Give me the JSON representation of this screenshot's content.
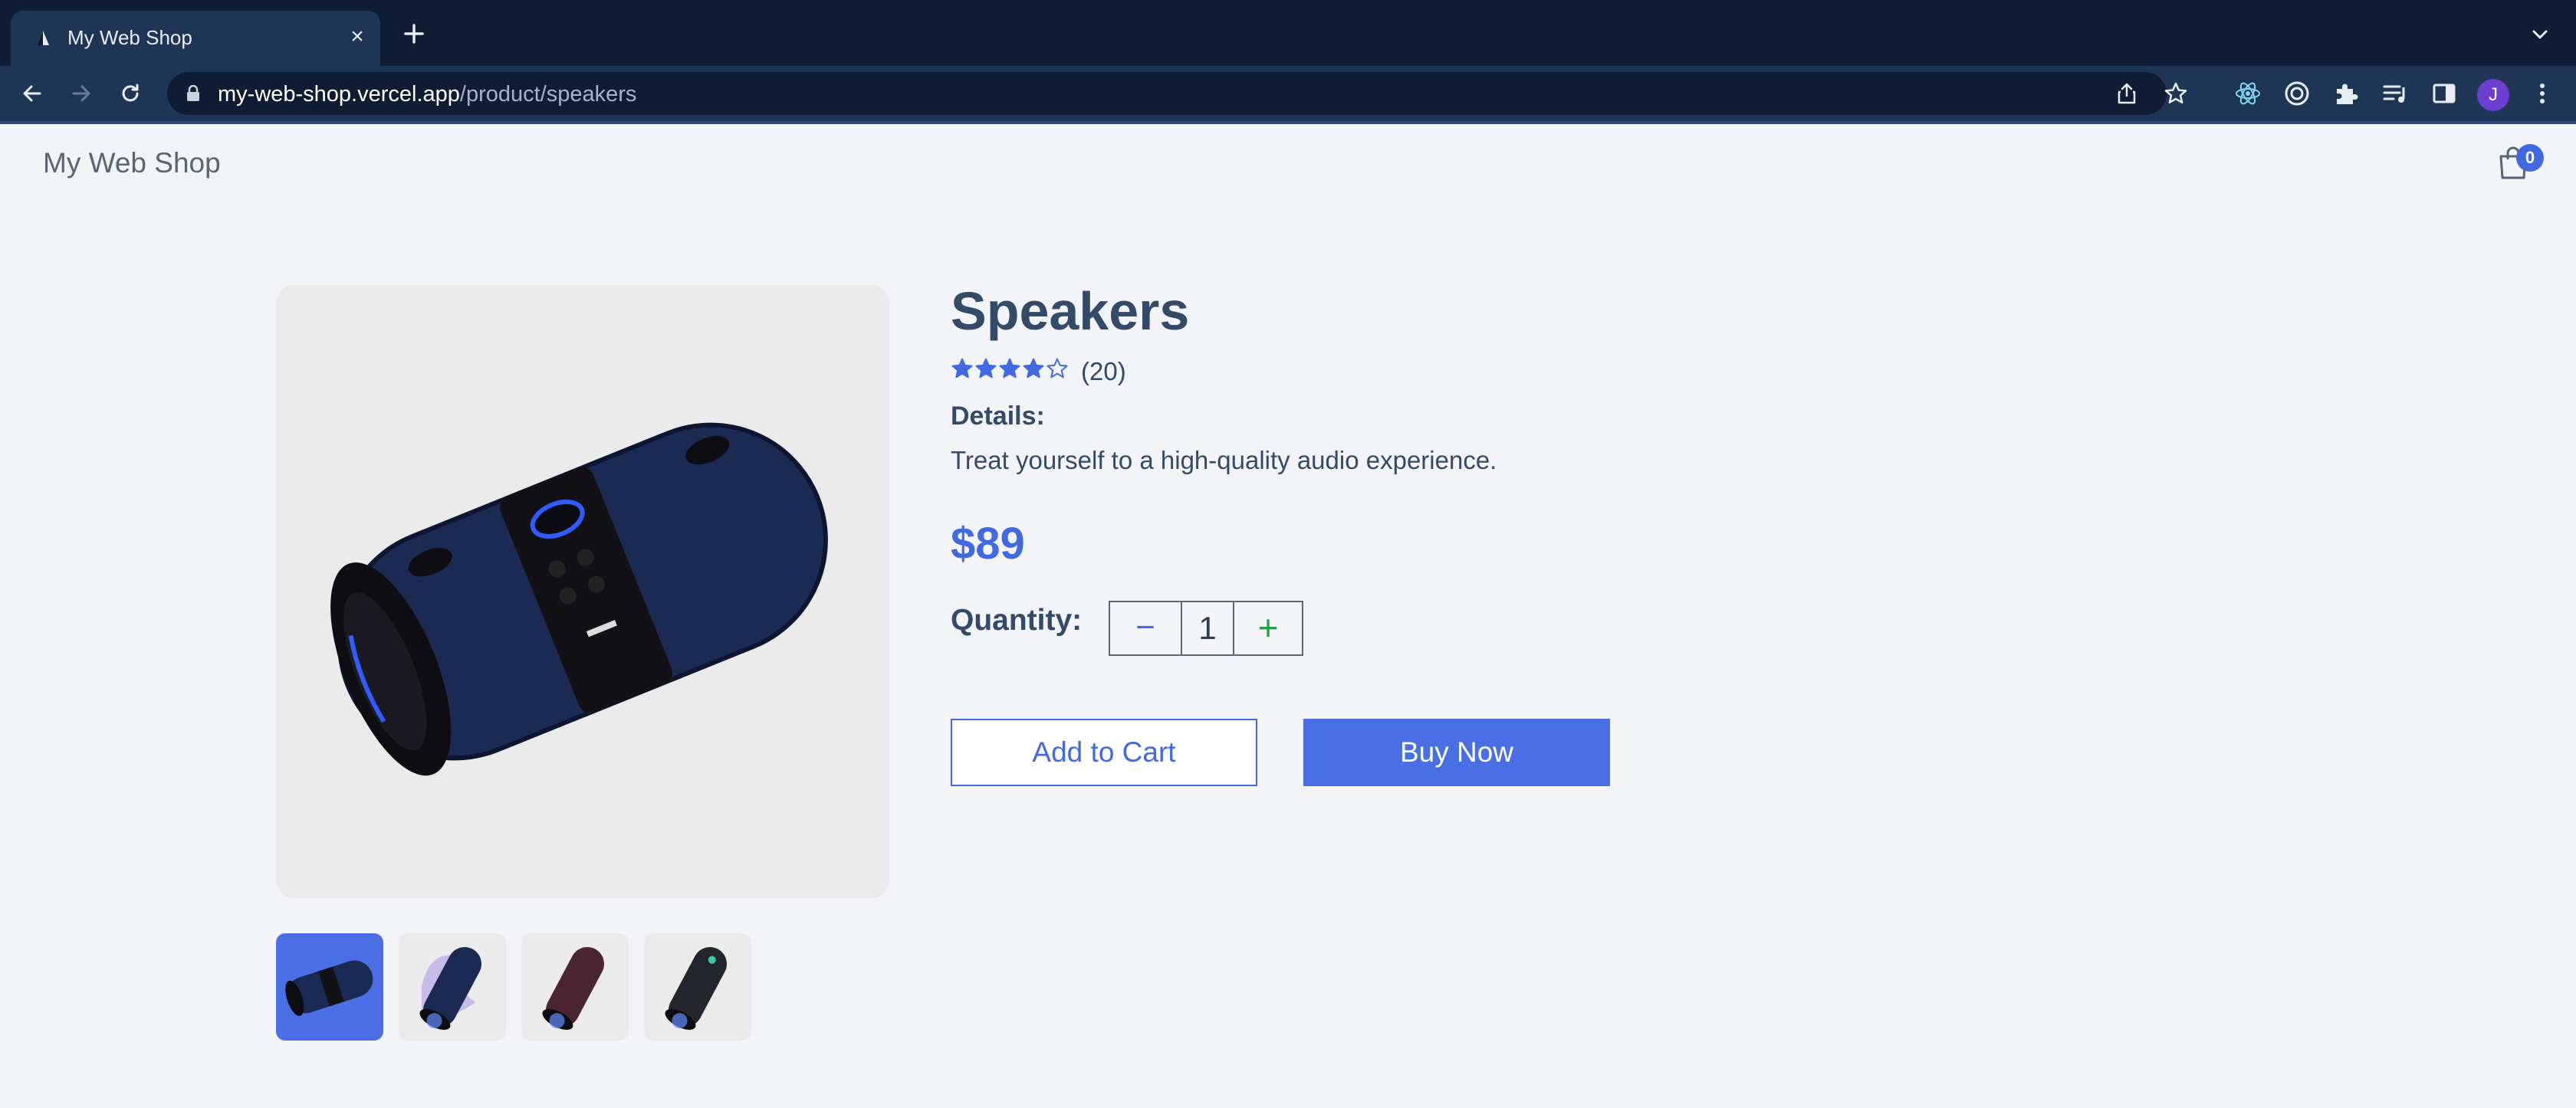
{
  "browser": {
    "tab_title": "My Web Shop",
    "url_host": "my-web-shop.vercel.app",
    "url_path": "/product/speakers",
    "profile_initial": "J"
  },
  "header": {
    "shop_name": "My Web Shop",
    "cart_count": "0"
  },
  "product": {
    "name": "Speakers",
    "rating": 4,
    "rating_max": 5,
    "review_count": "(20)",
    "details_label": "Details:",
    "details_text": "Treat yourself to a high-quality audio experience.",
    "price": "$89",
    "quantity_label": "Quantity:",
    "quantity": "1",
    "thumbnails": [
      {
        "name": "blue speaker",
        "active": true
      },
      {
        "name": "speaker with purple splash",
        "active": false
      },
      {
        "name": "red speaker",
        "active": false
      },
      {
        "name": "black speaker",
        "active": false
      }
    ]
  },
  "actions": {
    "add_to_cart": "Add to Cart",
    "buy_now": "Buy Now"
  },
  "colors": {
    "accent": "#4169e1",
    "title_text": "#334a68",
    "page_bg": "#f2f4f8",
    "browser_frame": "#0f1c33"
  }
}
